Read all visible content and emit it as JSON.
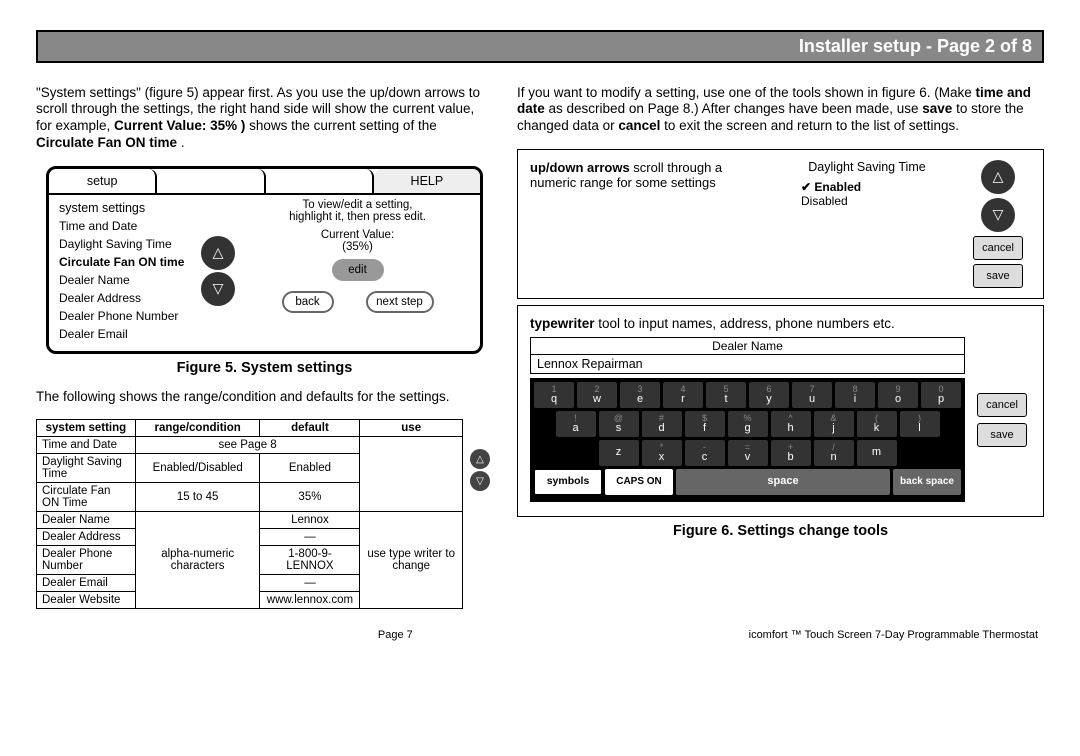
{
  "header": {
    "title": "Installer setup - Page 2 of 8"
  },
  "left": {
    "intro_parts": {
      "p1": "\"System settings\" (figure 5) appear first. As  you use  the up/down arrows to scroll through the settings, the right hand side will show the current value, for example, ",
      "b1": "Current Value: 35% )",
      "p2": " shows the current setting of the ",
      "b2": "Circulate Fan ON time",
      "p3": "."
    },
    "tabs": {
      "setup": "setup",
      "blank1": "",
      "blank2": "",
      "help": "HELP"
    },
    "list_title": "system settings",
    "list": [
      "Time and Date",
      "Daylight Saving Time",
      "Circulate Fan ON time",
      "Dealer Name",
      "Dealer Address",
      "Dealer Phone Number",
      "Dealer Email"
    ],
    "selected_index": 2,
    "hint_line1": "To view/edit a setting,",
    "hint_line2": "highlight it, then press edit.",
    "current_label": "Current Value:",
    "current_value": "(35%)",
    "btn_edit": "edit",
    "btn_back": "back",
    "btn_next": "next step",
    "fig5_caption": "Figure  5. System settings",
    "table_intro": "The following shows the range/condition and defaults for the settings.",
    "table": {
      "headers": [
        "system setting",
        "range/condition",
        "default",
        "use"
      ],
      "rows": [
        [
          "Time and Date",
          "see Page 8",
          "",
          ""
        ],
        [
          "Daylight Saving Time",
          "Enabled/Disabled",
          "Enabled",
          ""
        ],
        [
          "Circulate Fan ON Time",
          "15 to 45",
          "35%",
          ""
        ],
        [
          "Dealer Name",
          "",
          "Lennox",
          ""
        ],
        [
          "Dealer Address",
          "",
          "—",
          ""
        ],
        [
          "Dealer Phone Number",
          "alpha-numeric characters",
          "1-800-9-LENNOX",
          "use type writer to change"
        ],
        [
          "Dealer Email",
          "",
          "—",
          ""
        ],
        [
          "Dealer Website",
          "",
          "www.lennox.com",
          ""
        ]
      ]
    }
  },
  "right": {
    "intro_parts": {
      "p1": "If you want to modify a setting, use one of the tools shown in figure 6. (Make ",
      "b1": "time and date",
      "p2": " as described on Page 8.) After changes have been made, use ",
      "b2": "save",
      "p3": " to store the changed data or ",
      "b3": "cancel",
      "p4": " to exit the screen and return to the list of settings."
    },
    "dst": {
      "label_b": "up/down arrows",
      "label_rest": " scroll through a numeric range for some settings",
      "title": "Daylight Saving Time",
      "opt1": "Enabled",
      "opt2": "Disabled",
      "cancel": "cancel",
      "save": "save"
    },
    "tw": {
      "label_b": "typewriter",
      "label_rest": " tool to input names, address, phone numbers etc.",
      "field_name": "Dealer Name",
      "field_value": "Lennox Repairman",
      "row_num": [
        "1",
        "2",
        "3",
        "4",
        "5",
        "6",
        "7",
        "8",
        "9",
        "0"
      ],
      "row_q": [
        "q",
        "w",
        "e",
        "r",
        "t",
        "y",
        "u",
        "i",
        "o",
        "p"
      ],
      "row_sym": [
        "!",
        "@",
        "#",
        "$",
        "%",
        "^",
        "&",
        "(",
        ")"
      ],
      "row_a": [
        "a",
        "s",
        "d",
        "f",
        "g",
        "h",
        "j",
        "k",
        "l"
      ],
      "row_sym2": [
        "*",
        "-",
        "=",
        "+",
        "/"
      ],
      "row_z": [
        "z",
        "x",
        "c",
        "v",
        "b",
        "n",
        "m"
      ],
      "symbols": "symbols",
      "caps": "CAPS ON",
      "space": "space",
      "bksp": "back space",
      "cancel": "cancel",
      "save": "save"
    },
    "fig6_caption": "Figure  6. Settings change tools"
  },
  "footer": {
    "page": "Page 7",
    "product": "icomfort ™  Touch Screen 7-Day Programmable Thermostat"
  }
}
